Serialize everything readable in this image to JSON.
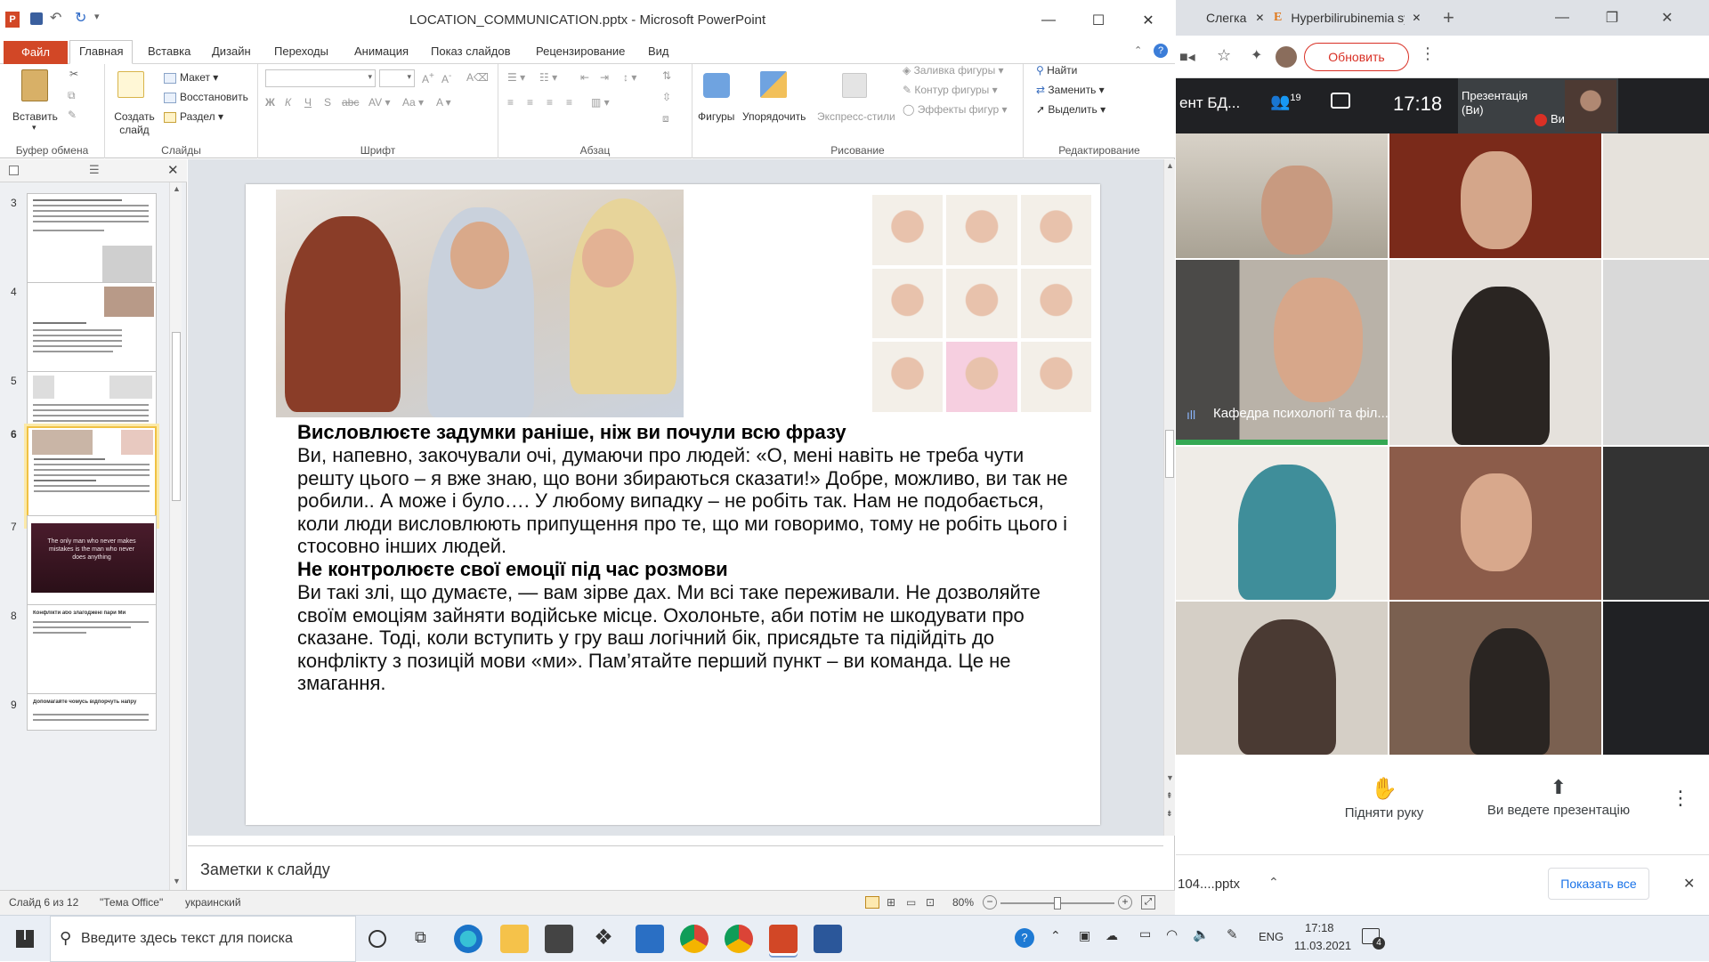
{
  "ppt": {
    "window_title": "LOCATION_COMMUNICATION.pptx - Microsoft PowerPoint",
    "tabs": [
      "Файл",
      "Главная",
      "Вставка",
      "Дизайн",
      "Переходы",
      "Анимация",
      "Показ слайдов",
      "Рецензирование",
      "Вид"
    ],
    "ribbon": {
      "clipboard": {
        "paste": "Вставить",
        "group": "Буфер обмена"
      },
      "slides": {
        "new_slide": "Создать слайд",
        "layout": "Макет",
        "reset": "Восстановить",
        "section": "Раздел",
        "group": "Слайды"
      },
      "font": {
        "group": "Шрифт",
        "bold": "Ж",
        "italic": "К",
        "underline": "Ч",
        "strike": "S",
        "shadow": "abc"
      },
      "paragraph": {
        "group": "Абзац"
      },
      "drawing": {
        "shapes": "Фигуры",
        "arrange": "Упорядочить",
        "quick_styles": "Экспресс-стили",
        "fill": "Заливка фигуры",
        "outline": "Контур фигуры",
        "effects": "Эффекты фигур",
        "group": "Рисование"
      },
      "editing": {
        "find": "Найти",
        "replace": "Заменить",
        "select": "Выделить",
        "group": "Редактирование"
      }
    },
    "thumbnails": [
      {
        "num": "3"
      },
      {
        "num": "4"
      },
      {
        "num": "5"
      },
      {
        "num": "6",
        "selected": true
      },
      {
        "num": "7",
        "quote": "The only man who never makes mistakes is the man who never does anything"
      },
      {
        "num": "8",
        "title": "Конфлікти або злагоджені пари Ми"
      },
      {
        "num": "9",
        "title": "Допомагайте чомусь відпорчуть напру"
      }
    ],
    "slide": {
      "heading1": "Висловлюєте задумки раніше, ніж ви почули всю фразу",
      "para1": "Ви, напевно, закочували очі, думаючи про людей: «О, мені навіть не треба чути решту цього – я вже знаю, що вони збираються сказати!» Добре, можливо, ви так не робили.. А може і було…. У любому випадку – не робіть так. Нам не подобається, коли люди висловлюють припущення про те, що ми говоримо, тому не робіть цього і стосовно інших людей.",
      "heading2": "Не контролюєте свої емоції під час розмови",
      "para2": "Ви такі злі, що думаєте, — вам зірве дах. Ми всі таке переживали. Не дозволяйте своїм емоціям зайняти водійське місце. Охолоньте, аби потім не шкодувати про сказане. Тоді, коли вступить у гру ваш логічний бік, присядьте та підійдіть до конфлікту з позицій мови «ми». Пам’ятайте перший пункт – ви команда. Це не змагання."
    },
    "notes_placeholder": "Заметки к слайду",
    "status": {
      "slide": "Слайд 6 из 12",
      "theme": "\"Тема Office\"",
      "lang": "украинский",
      "zoom": "80%"
    }
  },
  "chrome": {
    "tabs": [
      "Слегка",
      "Hyperbilirubinemia syn"
    ],
    "update_btn": "Обновить",
    "meet": {
      "title_trunc": "ент БД...",
      "participants": "19",
      "time": "17:18",
      "presenting_label": "Презентація (Ви)",
      "you_label": "Ви",
      "speaker_name": "Кафедра психології та філ...",
      "raise_hand": "Підняти руку",
      "presenting": "Ви ведете презентацію"
    },
    "download_file": "104....pptx",
    "show_all": "Показать все"
  },
  "taskbar": {
    "search_placeholder": "Введите здесь текст для поиска",
    "lang": "ENG",
    "time": "17:18",
    "date": "11.03.2021",
    "notif": "4"
  }
}
